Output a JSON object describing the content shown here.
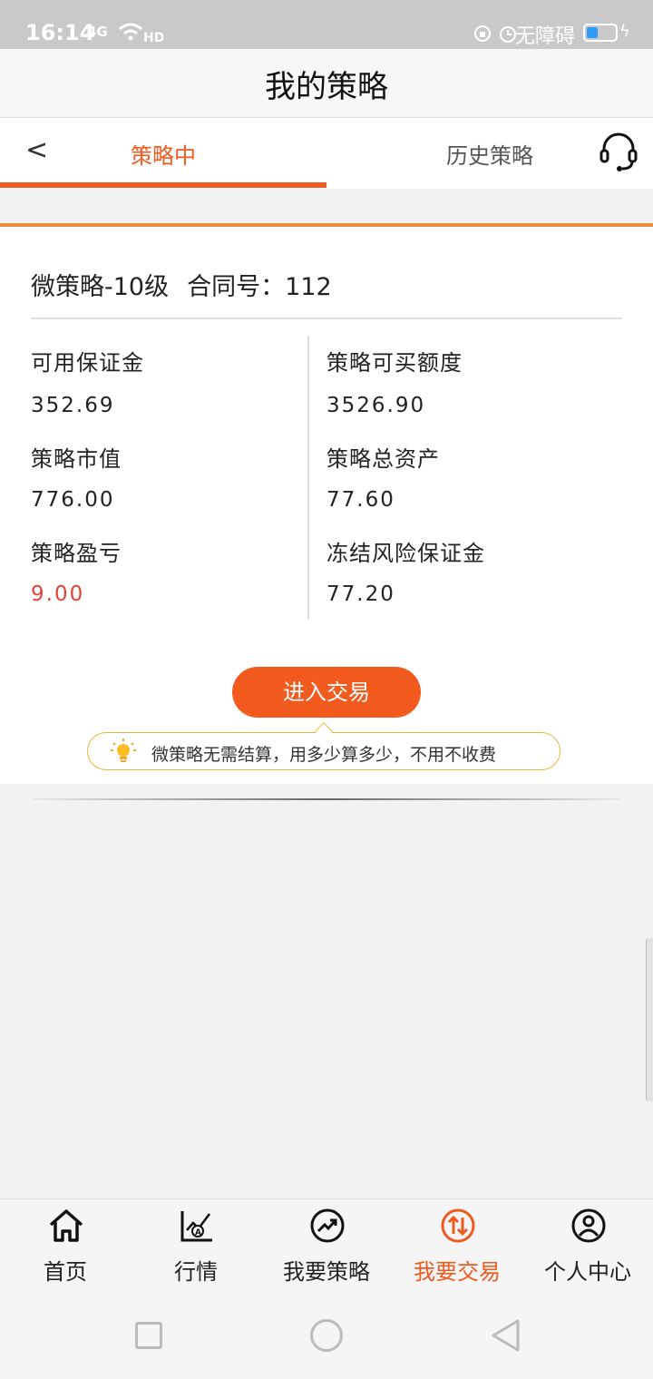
{
  "status_bar": {
    "time": "16:14",
    "signal": "4G",
    "wifi_label": "HD",
    "accessibility": "无障碍",
    "battery_percent": 35
  },
  "title_bar": {
    "title": "我的策略"
  },
  "tabs": {
    "back": "<",
    "active": "策略中",
    "history": "历史策略"
  },
  "strategy": {
    "name": "微策略-10级",
    "contract": "合同号：112",
    "left": [
      {
        "label": "可用保证金",
        "value": "352.69"
      },
      {
        "label": "策略市值",
        "value": "776.00"
      },
      {
        "label": "策略盈亏",
        "value": "9.00"
      }
    ],
    "right": [
      {
        "label": "策略可买额度",
        "value": "3526.90"
      },
      {
        "label": "策略总资产",
        "value": "77.60"
      },
      {
        "label": "冻结风险保证金",
        "value": "77.20"
      }
    ],
    "profit_color": "#e2443b",
    "enter_button": "进入交易",
    "tip": "微策略无需结算，用多少算多少，不用不收费"
  },
  "bottom_nav": [
    {
      "label": "首页",
      "icon": "home-icon"
    },
    {
      "label": "行情",
      "icon": "market-chart-icon"
    },
    {
      "label": "我要策略",
      "icon": "trend-up-icon"
    },
    {
      "label": "我要交易",
      "icon": "swap-arrows-icon",
      "active": true
    },
    {
      "label": "个人中心",
      "icon": "user-icon"
    }
  ],
  "colors": {
    "accent": "#f05a1e",
    "button": "#f35b1e",
    "tip_border": "#f0b43a"
  }
}
